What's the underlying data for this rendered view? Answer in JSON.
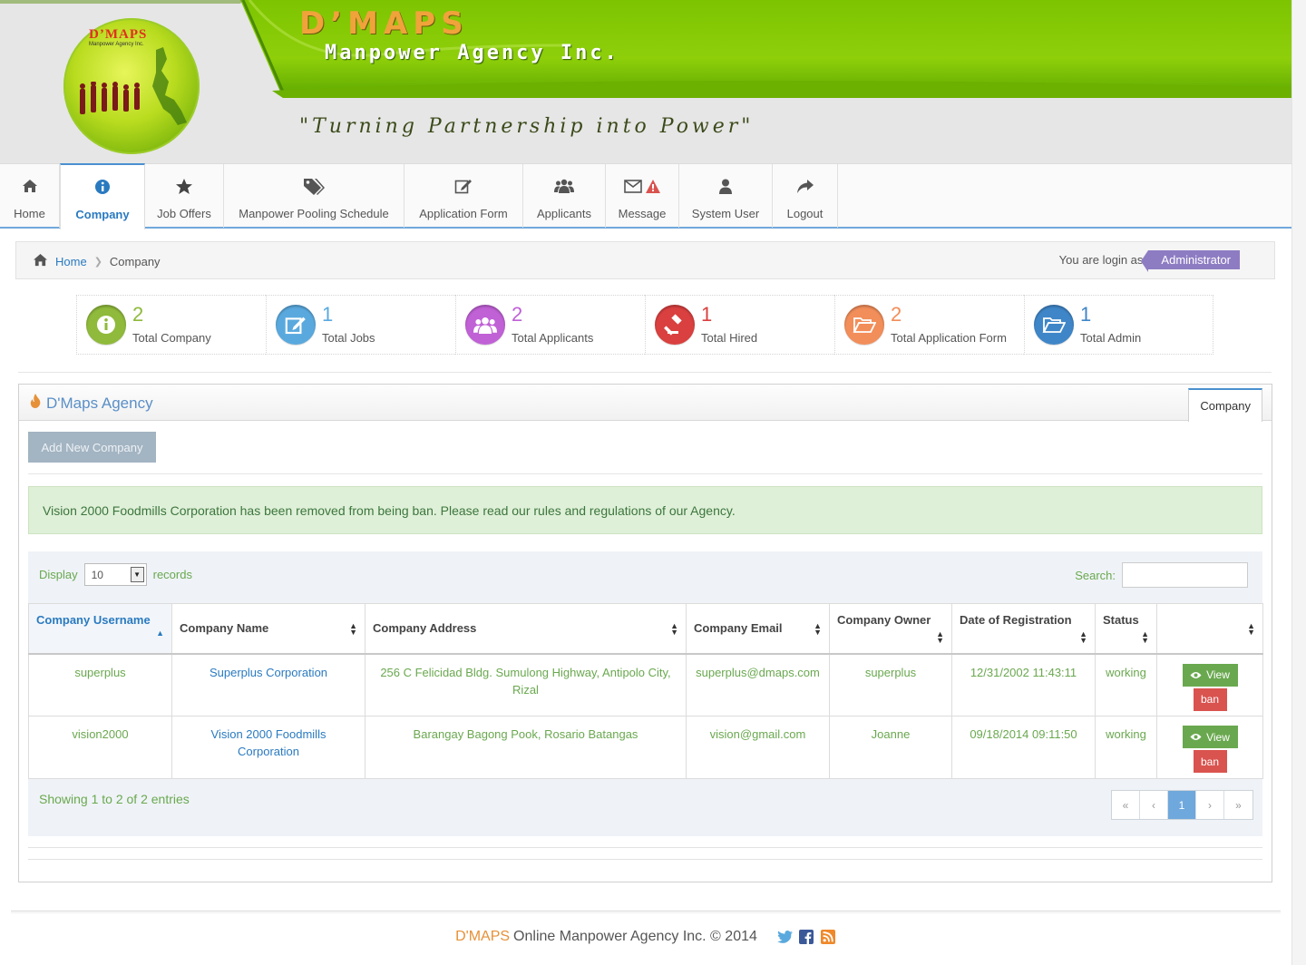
{
  "banner": {
    "title": "D’MAPS",
    "subtitle": "Manpower Agency Inc.",
    "tagline": "\"Turning Partnership into Power\"",
    "logo_text": "D’MAPS",
    "logo_sub": "Manpower Agency Inc."
  },
  "nav": {
    "items": [
      {
        "label": "Home",
        "icon": "home-icon"
      },
      {
        "label": "Company",
        "icon": "info-icon",
        "active": true
      },
      {
        "label": "Job Offers",
        "icon": "star-icon"
      },
      {
        "label": "Manpower Pooling Schedule",
        "icon": "tags-icon"
      },
      {
        "label": "Application Form",
        "icon": "edit-icon"
      },
      {
        "label": "Applicants",
        "icon": "users-icon"
      },
      {
        "label": "Message",
        "icon": "envelope-icon"
      },
      {
        "label": "System User",
        "icon": "user-icon"
      },
      {
        "label": "Logout",
        "icon": "share-icon"
      }
    ]
  },
  "breadcrumb": {
    "home": "Home",
    "current": "Company",
    "login_text": "You are login as",
    "role": "Administrator"
  },
  "stats": [
    {
      "value": "2",
      "label": "Total Company",
      "color": "#8fba3b",
      "icon": "info-icon"
    },
    {
      "value": "1",
      "label": "Total Jobs",
      "color": "#5aa9de",
      "icon": "edit-icon"
    },
    {
      "value": "2",
      "label": "Total Applicants",
      "color": "#c061d6",
      "icon": "users-icon"
    },
    {
      "value": "1",
      "label": "Total Hired",
      "color": "#d9403f",
      "icon": "gavel-icon"
    },
    {
      "value": "2",
      "label": "Total Application Form",
      "color": "#f28e5a",
      "icon": "folder-open-icon"
    },
    {
      "value": "1",
      "label": "Total Admin",
      "color": "#3f86c8",
      "icon": "folder-open-icon"
    }
  ],
  "panel": {
    "title": "D'Maps Agency",
    "tab": "Company",
    "add_button": "Add New Company",
    "alert": "Vision 2000 Foodmills Corporation has been removed from being ban. Please read our rules and regulations of our Agency."
  },
  "table": {
    "display_label": "Display",
    "display_value": "10",
    "records_label": "records",
    "search_label": "Search:",
    "columns": [
      "Company Username",
      "Company Name",
      "Company Address",
      "Company Email",
      "Company Owner",
      "Date of Registration",
      "Status",
      ""
    ],
    "rows": [
      {
        "username": "superplus",
        "name": "Superplus Corporation",
        "address": "256 C Felicidad Bldg. Sumulong Highway, Antipolo City, Rizal",
        "email": "superplus@dmaps.com",
        "owner": "superplus",
        "date": "12/31/2002 11:43:11",
        "status": "working"
      },
      {
        "username": "vision2000",
        "name": "Vision 2000 Foodmills Corporation",
        "address": "Barangay Bagong Pook, Rosario Batangas",
        "email": "vision@gmail.com",
        "owner": "Joanne",
        "date": "09/18/2014 09:11:50",
        "status": "working"
      }
    ],
    "view_label": "View",
    "ban_label": "ban",
    "info": "Showing 1 to 2 of 2 entries",
    "pager": {
      "first": "«",
      "prev": "‹",
      "current": "1",
      "next": "›",
      "last": "»"
    }
  },
  "footer": {
    "brand": "D'MAPS",
    "text": "Online Manpower Agency Inc. © 2014"
  }
}
